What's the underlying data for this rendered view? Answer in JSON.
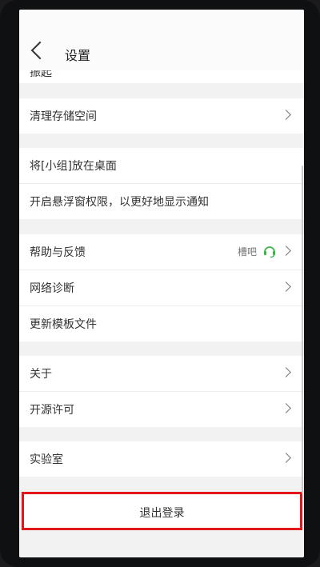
{
  "header": {
    "title": "设置"
  },
  "partial_row": {
    "label": "振起"
  },
  "rows": {
    "storage": "清理存储空间",
    "desktop": "将[小组]放在桌面",
    "floating": "开启悬浮窗权限，以更好地显示通知",
    "help": "帮助与反馈",
    "help_badge": "槽吧",
    "network": "网络诊断",
    "template": "更新模板文件",
    "about": "关于",
    "license": "开源许可",
    "lab": "实验室"
  },
  "logout": {
    "label": "退出登录"
  },
  "colors": {
    "background": "#f2f2f2",
    "card": "#ffffff",
    "highlight_border": "#e2161b",
    "headset_icon": "#3bb54a"
  }
}
